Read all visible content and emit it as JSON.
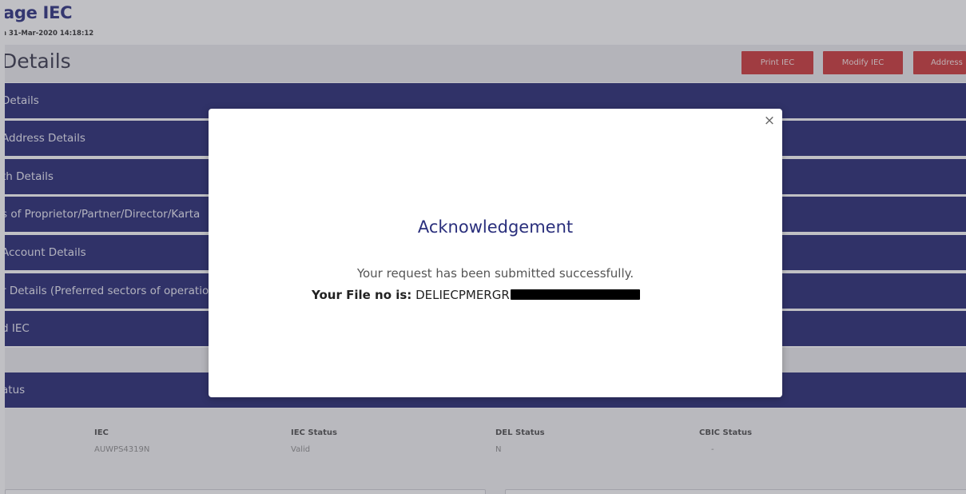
{
  "page": {
    "title": "age IEC",
    "subtitle": "n 31-Mar-2020 14:18:12",
    "section_title": "Details",
    "buttons": {
      "print": "Print IEC",
      "modify": "Modify IEC",
      "address": "Address"
    }
  },
  "accordion": [
    {
      "label": "Details"
    },
    {
      "label": "Address Details"
    },
    {
      "label": "th Details"
    },
    {
      "label": "s of Proprietor/Partner/Director/Karta"
    },
    {
      "label": "Account Details"
    },
    {
      "label": "r Details (Preferred sectors of operatio"
    },
    {
      "label": "d IEC"
    },
    {
      "label": "atus"
    }
  ],
  "status_table": {
    "headers": [
      "IEC",
      "IEC Status",
      "DEL Status",
      "CBIC Status"
    ],
    "values": [
      "AUWPS4319N",
      "Valid",
      "N",
      "-"
    ]
  },
  "modal": {
    "close_label": "×",
    "title": "Acknowledgement",
    "message": "Your request has been submitted successfully.",
    "file_label": "Your File no is:",
    "file_number_visible": "DELIECPMERGR"
  },
  "colors": {
    "navy": "#181b6b",
    "title_blue": "#1e2378",
    "button_red": "#cc2a2c",
    "modal_heading": "#2a2f7c"
  }
}
